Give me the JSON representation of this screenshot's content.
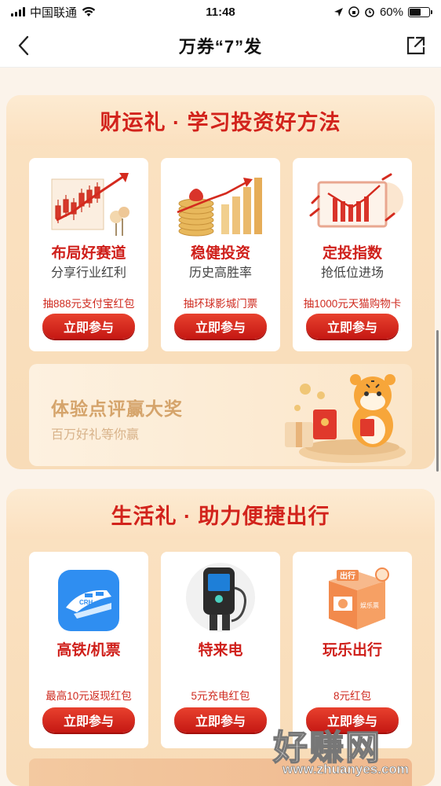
{
  "status_bar": {
    "carrier": "中国联通",
    "time": "11:48",
    "battery": "60%",
    "battery_level": 0.6
  },
  "nav": {
    "title": "万券“7”发"
  },
  "section1": {
    "title": "财运礼 · 学习投资好方法",
    "cards": [
      {
        "title": "布局好赛道",
        "subtitle": "分享行业红利",
        "prize": "抽888元支付宝红包",
        "button": "立即参与"
      },
      {
        "title": "稳健投资",
        "subtitle": "历史高胜率",
        "prize": "抽环球影城门票",
        "button": "立即参与"
      },
      {
        "title": "定投指数",
        "subtitle": "抢低位进场",
        "prize": "抽1000元天猫购物卡",
        "button": "立即参与"
      }
    ],
    "banner": {
      "title": "体验点评赢大奖",
      "subtitle": "百万好礼等你赢"
    }
  },
  "section2": {
    "title": "生活礼 · 助力便捷出行",
    "cards": [
      {
        "title": "高铁/机票",
        "prize": "最高10元返现红包",
        "button": "立即参与",
        "icon_text": "CRH"
      },
      {
        "title": "特来电",
        "prize": "5元充电红包",
        "button": "立即参与"
      },
      {
        "title": "玩乐出行",
        "prize": "8元红包",
        "button": "立即参与",
        "icon_text": "出行",
        "box_text": "娱乐票"
      }
    ]
  },
  "watermark": {
    "text": "好赚网",
    "url": "www.zhuanyes.com"
  },
  "colors": {
    "accent_red": "#d2231c",
    "section_bg": "#f8dcb8",
    "banner_text": "#d5a46b"
  }
}
